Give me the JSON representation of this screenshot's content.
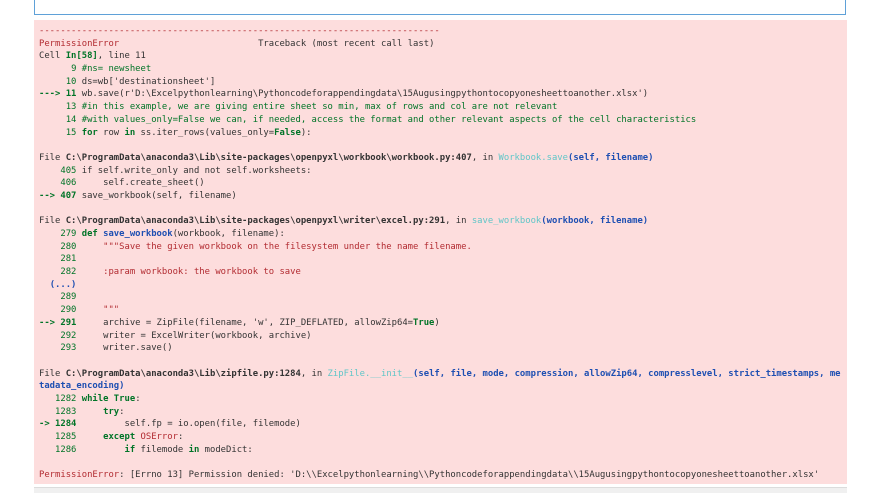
{
  "output": {
    "separator": "---------------------------------------------------------------------------",
    "header": {
      "error": "PermissionError",
      "traceback": "Traceback (most recent call last)"
    },
    "cell_ref": {
      "prefix": "Cell ",
      "cell": "In[58]",
      "line": ", line 11"
    },
    "frame1": [
      {
        "num": "9",
        "code": "#ns= newsheet"
      },
      {
        "num": "10",
        "code": "ds=wb['destinationsheet']"
      },
      {
        "arrow": "---> ",
        "num": "11",
        "code": "wb.save(r'D:\\Excelpythonlearning\\Pythoncodeforappendingdata\\15Augusingpythontocopyonesheettoanother.xlsx')"
      },
      {
        "num": "13",
        "code": "#in this example, we are giving entire sheet so min, max of rows and col are not relevant"
      },
      {
        "num": "14",
        "code": "#with values_only=False we can, if needed, access the format and other relevant aspects of the cell characteristics"
      },
      {
        "num": "15",
        "kw1": "for",
        "code_a": " row ",
        "kw2": "in",
        "code_b": " ss.iter_rows(values_only=",
        "kw3": "False",
        "code_c": "):"
      }
    ],
    "frame2": {
      "file_label": "File ",
      "path": "C:\\ProgramData\\anaconda3\\Lib\\site-packages\\openpyxl\\workbook\\workbook.py:407",
      "in_text": ", in ",
      "func": "Workbook.save",
      "args": "(self, filename)",
      "lines": [
        {
          "num": "405",
          "code": "if self.write_only and not self.worksheets:"
        },
        {
          "num": "406",
          "code": "    self.create_sheet()"
        },
        {
          "arrow": "--> ",
          "num": "407",
          "code": "save_workbook(self, filename)"
        }
      ]
    },
    "frame3": {
      "file_label": "File ",
      "path": "C:\\ProgramData\\anaconda3\\Lib\\site-packages\\openpyxl\\writer\\excel.py:291",
      "in_text": ", in ",
      "func": "save_workbook",
      "args": "(workbook, filename)",
      "lines": [
        {
          "num": "279",
          "kw": "def",
          "code": "save_workbook",
          "rest": "(workbook, filename):"
        },
        {
          "num": "280",
          "code": "    \"\"\"Save the given workbook on the filesystem under the name filename."
        },
        {
          "num": "281",
          "code": ""
        },
        {
          "num": "282",
          "code": "    :param workbook: the workbook to save"
        },
        {
          "ellipsis": "(...)"
        },
        {
          "num": "289",
          "code": ""
        },
        {
          "num": "290",
          "code": "    \"\"\""
        },
        {
          "arrow": "--> ",
          "num": "291",
          "code": "    archive = ZipFile(filename, 'w', ZIP_DEFLATED, allowZip64=",
          "kw": "True",
          "rest": ")"
        },
        {
          "num": "292",
          "code": "    writer = ExcelWriter(workbook, archive)"
        },
        {
          "num": "293",
          "code": "    writer.save()"
        }
      ]
    },
    "frame4": {
      "file_label": "File ",
      "path": "C:\\ProgramData\\anaconda3\\Lib\\zipfile.py:1284",
      "in_text": ", in ",
      "func": "ZipFile.__init__",
      "args_line1": "(self, file, mode, compression, allowZip64, compresslevel, strict_timestamps, me",
      "args_line2": "tadata_encoding)",
      "lines": [
        {
          "num": "1282",
          "kw": "while",
          "code": " True",
          "rest": ":"
        },
        {
          "num": "1283",
          "kw": "    try",
          "rest": ":"
        },
        {
          "arrow": "-> ",
          "num": "1284",
          "code": "        self.fp = io.open(file, filemode)"
        },
        {
          "num": "1285",
          "kw": "    except",
          "exc": " OSError",
          "rest": ":"
        },
        {
          "num": "1286",
          "kw": "        if",
          "code": " filemode ",
          "kw2": "in",
          "rest": " modeDict:"
        }
      ]
    },
    "final_error": {
      "name": "PermissionError",
      "message": ": [Errno 13] Permission denied: 'D:\\\\Excelpythonlearning\\\\Pythoncodeforappendingdata\\\\15Augusingpythontocopyonesheettoanother.xlsx'"
    }
  }
}
